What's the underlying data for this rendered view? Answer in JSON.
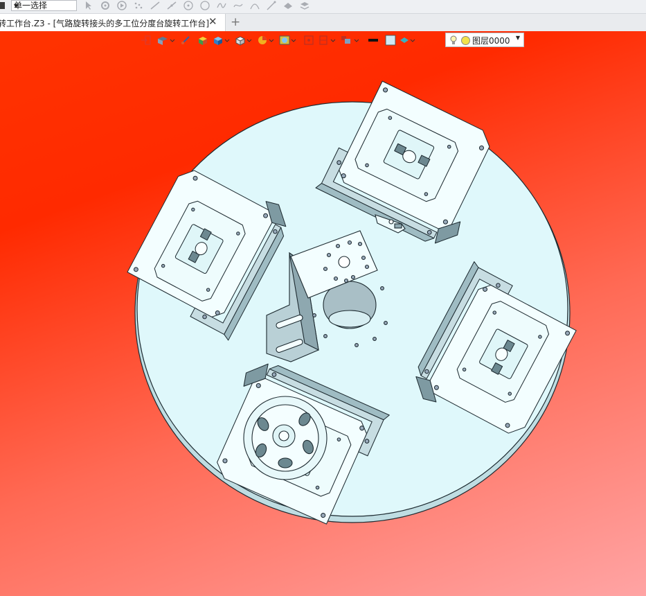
{
  "toolbar": {
    "select_mode": "单一选择",
    "tools": [
      "arrow-select-icon",
      "filter-icon",
      "play-icon",
      "point-icon",
      "line-icon",
      "segment-icon",
      "circle-center-icon",
      "circle-icon",
      "spline-icon",
      "curve-icon",
      "arc-icon",
      "sketch-tool-icon",
      "eraser-icon",
      "stack-icon"
    ]
  },
  "tabs": {
    "active_title": "转工作台.Z3 - [气路旋转接头的多工位分度台旋转工作台]",
    "close_symbol": "✕",
    "new_tab_symbol": "+"
  },
  "view_toolbar": {
    "layer_label": "图层0000"
  },
  "colors": {
    "viewport_top": "#ff2a00",
    "viewport_bottom": "#ffa4a4",
    "table_fill": "#dff8fb",
    "part_fill": "#f3feff",
    "line": "#1d2a30"
  }
}
